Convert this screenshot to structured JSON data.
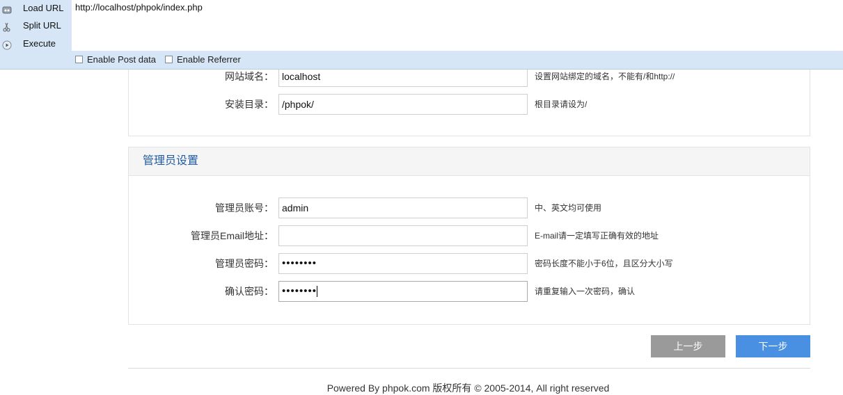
{
  "hackbar": {
    "menu": {
      "load_url": "Load URL",
      "split_url": "Split URL",
      "execute": "Execute"
    },
    "url_value": "http://localhost/phpok/index.php",
    "options": {
      "enable_post": "Enable Post data",
      "enable_referrer": "Enable Referrer"
    }
  },
  "site_settings": {
    "domain": {
      "label": "网站域名：",
      "value": "localhost",
      "hint": "设置网站绑定的域名，不能有/和http://"
    },
    "install_dir": {
      "label": "安装目录：",
      "value": "/phpok/",
      "hint": "根目录请设为/"
    }
  },
  "admin_settings": {
    "title": "管理员设置",
    "account": {
      "label": "管理员账号：",
      "value": "admin",
      "hint": "中、英文均可使用"
    },
    "email": {
      "label": "管理员Email地址：",
      "value": "",
      "hint": "E-mail请一定填写正确有效的地址"
    },
    "password": {
      "label": "管理员密码：",
      "value": "••••••••",
      "hint": "密码长度不能小于6位，且区分大小写"
    },
    "confirm_password": {
      "label": "确认密码：",
      "value": "••••••••",
      "hint": "请重复输入一次密码，确认"
    }
  },
  "buttons": {
    "prev": "上一步",
    "next": "下一步"
  },
  "footer": "Powered By phpok.com 版权所有 © 2005-2014, All right reserved",
  "colors": {
    "toolbar_bg": "#d6e6f6",
    "next_button": "#4a90e2",
    "prev_button": "#9a9a9a",
    "section_title": "#1f5ba5"
  }
}
